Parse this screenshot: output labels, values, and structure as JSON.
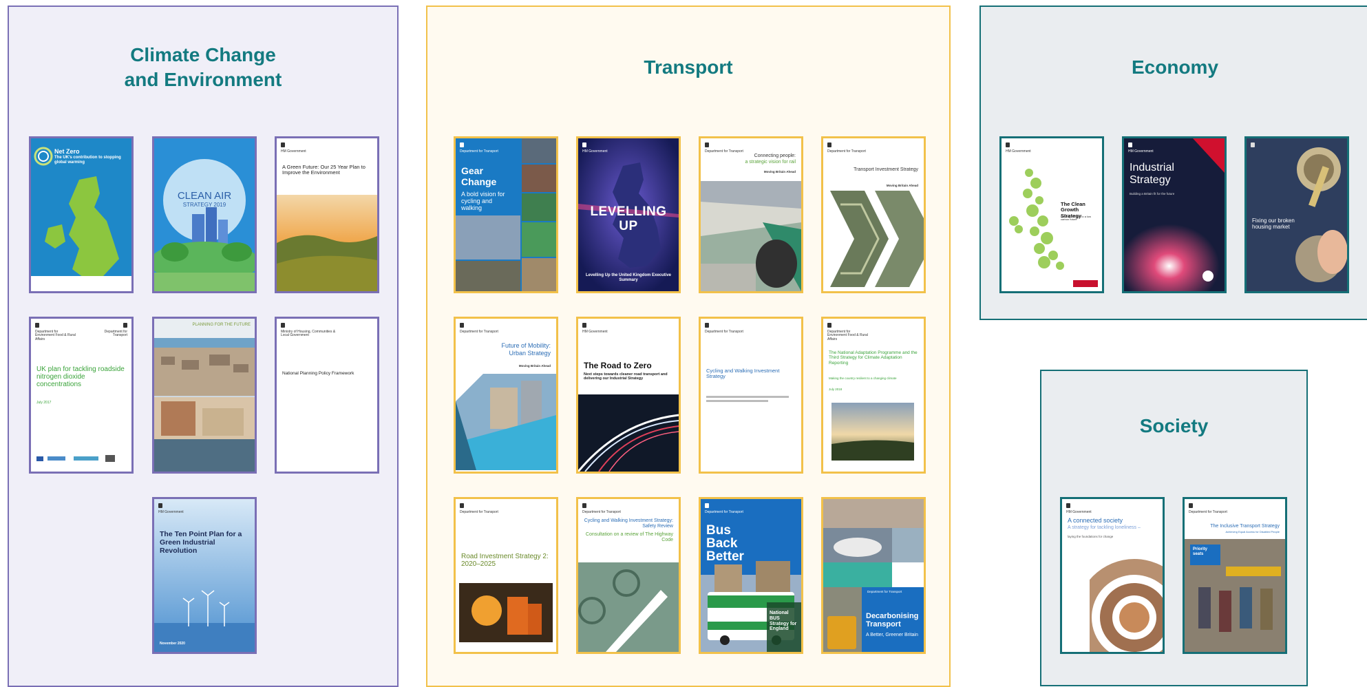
{
  "panels": {
    "climate": {
      "title_line1": "Climate Change",
      "title_line2": "and Environment",
      "border": "#7a6fb5",
      "background": "#f0eff8",
      "covers": [
        {
          "title": "Net Zero",
          "subtitle": "The UK's contribution to stopping global warming"
        },
        {
          "title": "CLEAN AIR",
          "subtitle": "STRATEGY 2019"
        },
        {
          "title": "A Green Future: Our 25 Year Plan to Improve the Environment"
        },
        {
          "title": "UK plan for tackling roadside nitrogen dioxide concentrations",
          "date": "July 2017"
        },
        {
          "title": "PLANNING FOR THE FUTURE"
        },
        {
          "title": "National Planning Policy Framework",
          "org": "Ministry of Housing, Communities & Local Government"
        },
        {
          "title": "The Ten Point Plan for a Green Industrial Revolution",
          "date": "November 2020"
        }
      ]
    },
    "transport": {
      "title": "Transport",
      "border": "#f2c14a",
      "background": "#fffaf0",
      "covers": [
        {
          "title": "Gear Change",
          "subtitle": "A bold vision for cycling and walking"
        },
        {
          "title": "LEVELLING UP",
          "subtitle": "Levelling Up the United Kingdom Executive Summary"
        },
        {
          "title": "Connecting people:",
          "subtitle": "a strategic vision for rail",
          "tag": "Moving Britain Ahead"
        },
        {
          "title": "Transport Investment Strategy",
          "tag": "Moving Britain Ahead"
        },
        {
          "title": "Future of Mobility:",
          "subtitle": "Urban Strategy",
          "tag": "Moving Britain Ahead"
        },
        {
          "title": "The Road to Zero",
          "subtitle": "Next steps towards cleaner road transport and delivering our Industrial Strategy"
        },
        {
          "title": "Cycling and Walking Investment Strategy"
        },
        {
          "title": "The National Adaptation Programme and the Third Strategy for Climate Adaptation Reporting",
          "subtitle": "Making the country resilient to a changing climate",
          "date": "July 2018"
        },
        {
          "title": "Road Investment Strategy 2: 2020–2025"
        },
        {
          "title": "Cycling and Walking Investment Strategy: Safety Review",
          "subtitle": "Consultation on a review of The Highway Code"
        },
        {
          "title": "Bus Back Better",
          "subtitle": "National BUS Strategy for England"
        },
        {
          "title": "Decarbonising Transport",
          "subtitle": "A Better, Greener Britain"
        }
      ]
    },
    "economy": {
      "title": "Economy",
      "border": "#156f76",
      "background": "#eaedf0",
      "covers": [
        {
          "title": "The Clean Growth Strategy",
          "subtitle": "Leading the way to a low carbon future"
        },
        {
          "title": "Industrial Strategy",
          "subtitle": "Building a Britain fit for the future"
        },
        {
          "title": "Fixing our broken housing market"
        }
      ]
    },
    "society": {
      "title": "Society",
      "border": "#156f76",
      "background": "#eaedf0",
      "covers": [
        {
          "title": "A connected society",
          "subtitle": "A strategy for tackling loneliness –",
          "tag": "laying the foundations for change"
        },
        {
          "title": "The Inclusive Transport Strategy",
          "subtitle": "Achieving Equal Access for Disabled People",
          "sign": "Priority seats"
        }
      ]
    }
  },
  "labels": {
    "hm_government": "HM Government",
    "dft": "Department for Transport",
    "defra": "Department for Environment Food & Rural Affairs"
  }
}
